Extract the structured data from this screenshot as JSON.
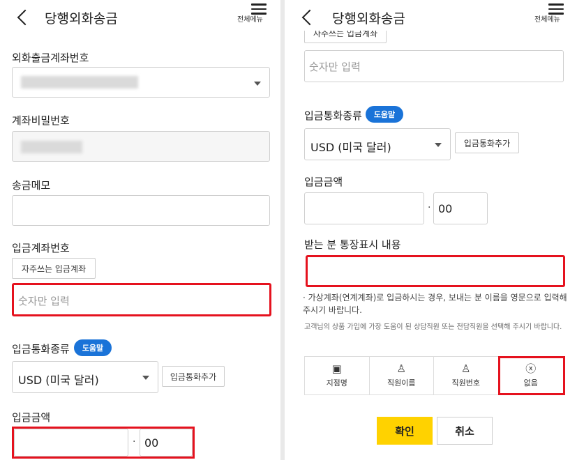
{
  "header": {
    "title": "당행외화송금",
    "menu_label": "전체메뉴"
  },
  "left": {
    "withdraw_account_label": "외화출금계좌번호",
    "password_label": "계좌비밀번호",
    "memo_label": "송금메모",
    "deposit_account_label": "입금계좌번호",
    "favorite_button": "자주쓰는 입금계좌",
    "account_placeholder": "숫자만 입력",
    "currency_label": "입금통화종류",
    "help_badge": "도움말",
    "currency_value": "USD (미국 달러)",
    "add_currency_button": "입금통화추가",
    "amount_label": "입금금액",
    "decimal_sep": "·",
    "decimal_value": "00"
  },
  "right": {
    "favorite_button_cut": "자주쓰는 입금계좌",
    "account_placeholder": "숫자만 입력",
    "currency_label": "입금통화종류",
    "help_badge": "도움말",
    "currency_value": "USD (미국 달러)",
    "add_currency_button": "입금통화추가",
    "amount_label": "입금금액",
    "decimal_sep": "·",
    "decimal_value": "00",
    "passbook_label": "받는 분 통장표시 내용",
    "note": "· 가상계좌(연계계좌)로 입금하시는 경우, 보내는 분 이름을 영문으로 입력해주시기 바랍니다.",
    "staff_note": "고객님의 상품 가입에 가장 도움이 된 상담직원 또는 전담직원을 선택해 주시기 바랍니다.",
    "options": [
      {
        "label": "지점명",
        "icon": "branch-icon"
      },
      {
        "label": "직원이름",
        "icon": "person-icon"
      },
      {
        "label": "직원번호",
        "icon": "person-number-icon"
      },
      {
        "label": "없음",
        "icon": "none-icon"
      }
    ],
    "confirm": "확인",
    "cancel": "취소"
  },
  "colors": {
    "highlight": "#e5121e",
    "help_badge": "#1a73d8",
    "confirm_button": "#ffd200"
  }
}
